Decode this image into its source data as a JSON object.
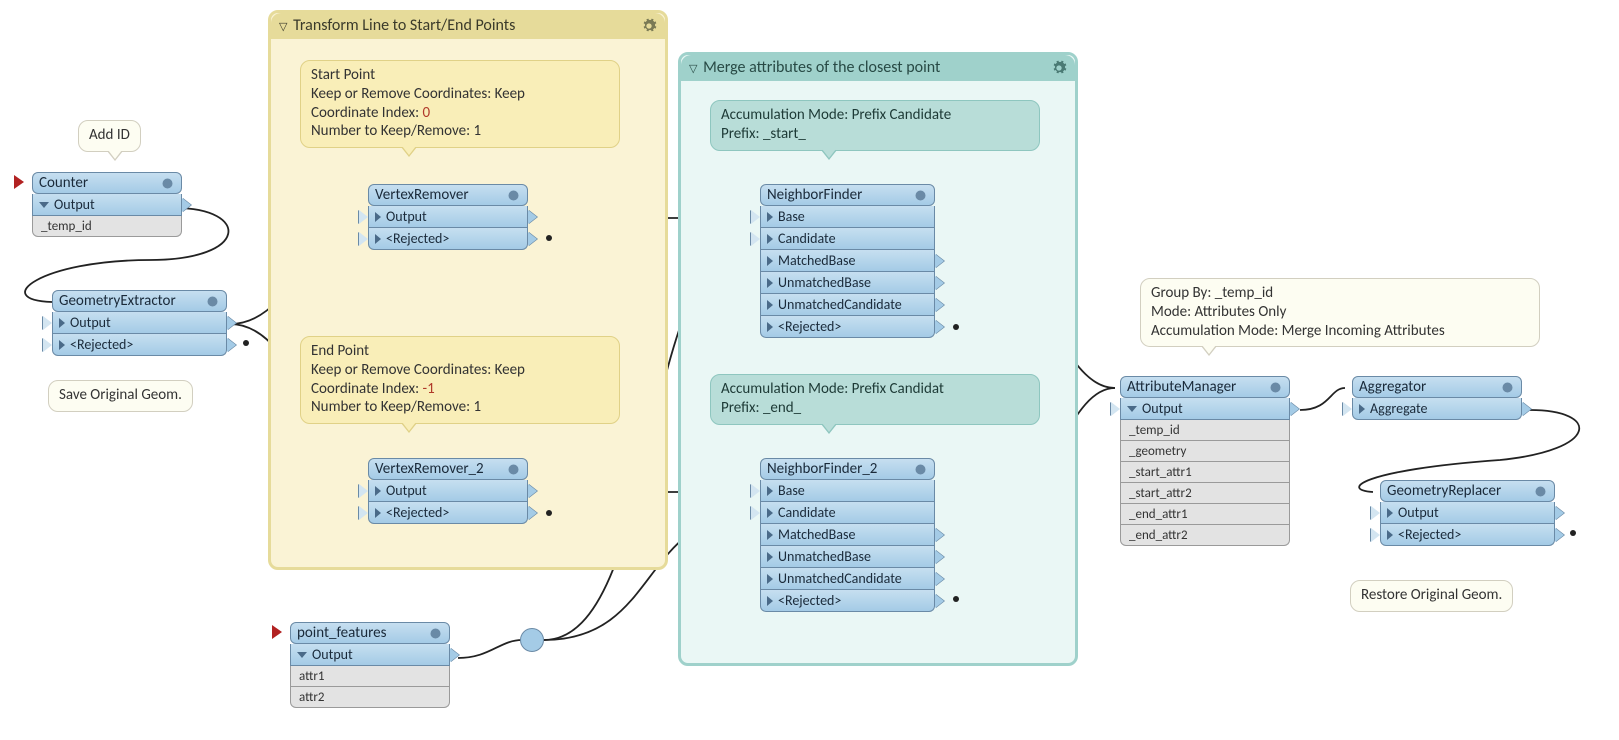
{
  "bookmarks": {
    "transform": "Transform Line to Start/End Points",
    "merge": "Merge attributes of the closest point"
  },
  "callouts": {
    "addId": "Add ID",
    "saveGeom": "Save Original Geom.",
    "startPoint": {
      "title": "Start Point",
      "l1a": "Keep or Remove Coordinates: Keep",
      "l2a": "Coordinate Index: ",
      "l2b": "0",
      "l3": "Number to Keep/Remove: 1"
    },
    "endPoint": {
      "title": "End Point",
      "l1a": "Keep or Remove Coordinates: Keep",
      "l2a": "Coordinate Index: ",
      "l2b": "-1",
      "l3": "Number to Keep/Remove: 1"
    },
    "nf1": {
      "l1": "Accumulation Mode: Prefix Candidate",
      "l2": "Prefix: _start_"
    },
    "nf2": {
      "l1": "Accumulation Mode: Prefix Candidat",
      "l2": "Prefix: _end_"
    },
    "am": {
      "l1": "Group By: _temp_id",
      "l2": "Mode: Attributes Only",
      "l3": "Accumulation Mode: Merge Incoming Attributes"
    },
    "restore": "Restore Original Geom."
  },
  "nodes": {
    "counter": {
      "name": "Counter",
      "out": "Output",
      "attrs": [
        "_temp_id"
      ]
    },
    "geomEx": {
      "name": "GeometryExtractor",
      "out": "Output",
      "rej": "<Rejected>"
    },
    "vr1": {
      "name": "VertexRemover",
      "out": "Output",
      "rej": "<Rejected>"
    },
    "vr2": {
      "name": "VertexRemover_2",
      "out": "Output",
      "rej": "<Rejected>"
    },
    "pf": {
      "name": "point_features",
      "out": "Output",
      "attrs": [
        "attr1",
        "attr2"
      ]
    },
    "nf1": {
      "name": "NeighborFinder",
      "p": [
        "Base",
        "Candidate",
        "MatchedBase",
        "UnmatchedBase",
        "UnmatchedCandidate",
        "<Rejected>"
      ]
    },
    "nf2": {
      "name": "NeighborFinder_2",
      "p": [
        "Base",
        "Candidate",
        "MatchedBase",
        "UnmatchedBase",
        "UnmatchedCandidate",
        "<Rejected>"
      ]
    },
    "am": {
      "name": "AttributeManager",
      "out": "Output",
      "attrs": [
        "_temp_id",
        "_geometry",
        "_start_attr1",
        "_start_attr2",
        "_end_attr1",
        "_end_attr2"
      ]
    },
    "agg": {
      "name": "Aggregator",
      "p1": "Aggregate"
    },
    "gr": {
      "name": "GeometryReplacer",
      "out": "Output",
      "rej": "<Rejected>"
    }
  }
}
